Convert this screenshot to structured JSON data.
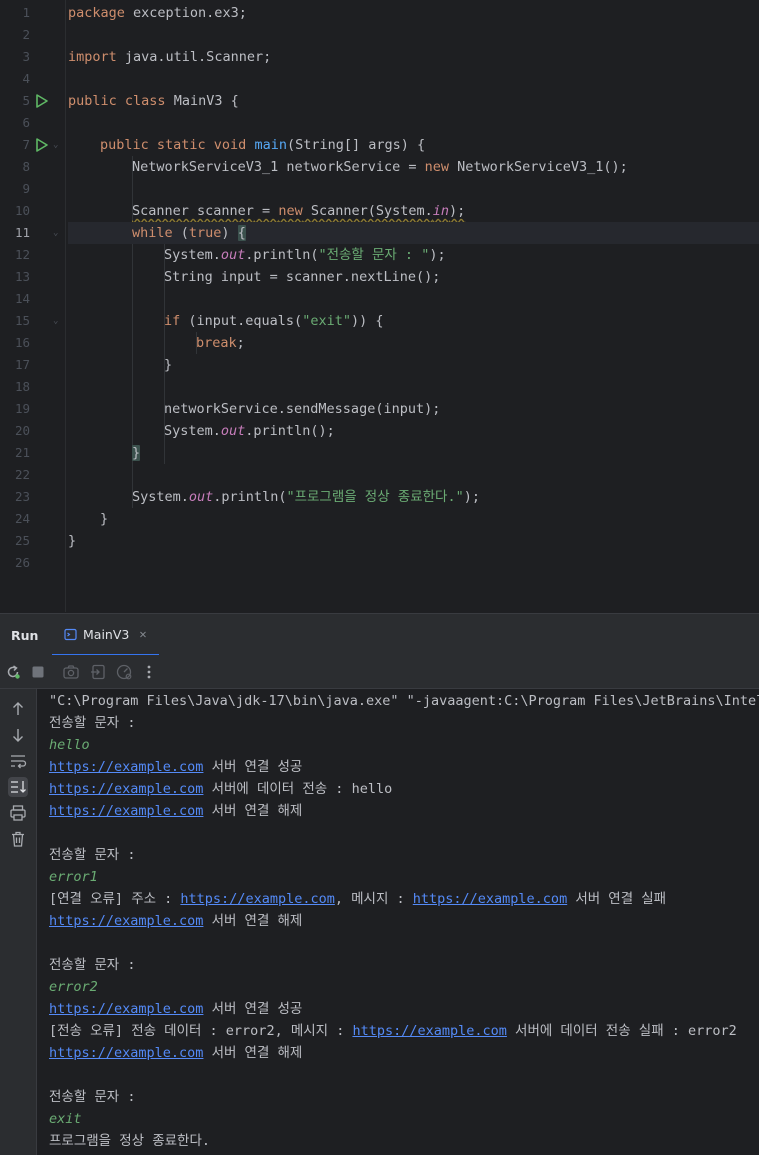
{
  "editor": {
    "line_numbers": [
      "1",
      "2",
      "3",
      "4",
      "5",
      "6",
      "7",
      "8",
      "9",
      "10",
      "11",
      "12",
      "13",
      "14",
      "15",
      "16",
      "17",
      "18",
      "19",
      "20",
      "21",
      "22",
      "23",
      "24",
      "25",
      "26"
    ],
    "current_line": "11",
    "code": {
      "l1_pkg_kw": "package",
      "l1_pkg": " exception.ex3;",
      "l3_imp_kw": "import",
      "l3_imp": " java.util.Scanner;",
      "l5_public": "public",
      "l5_class": " class",
      "l5_rest": " MainV3 {",
      "l7_mods": "public static void",
      "l7_main": "main",
      "l7_rest": "(String[] args) {",
      "l8_a": "NetworkServiceV3_1 networkService = ",
      "l8_new": "new",
      "l8_b": " NetworkServiceV3_1();",
      "l10_decl": "Scanner scanner",
      "l10_eq": " = ",
      "l10_new": "new",
      "l10_b": " Scanner(System.",
      "l10_in": "in",
      "l10_c": ");",
      "l11_while": "while",
      "l11_b": " (",
      "l11_true": "true",
      "l11_c": ") ",
      "l11_brace": "{",
      "l12_a": "System.",
      "l12_out": "out",
      "l12_b": ".println(",
      "l12_str": "\"전송할 문자 : \"",
      "l12_c": ");",
      "l13": "String input = scanner.nextLine();",
      "l15_if": "if",
      "l15_a": " (input.equals(",
      "l15_str": "\"exit\"",
      "l15_b": ")) {",
      "l16_break": "break",
      "l16_semi": ";",
      "l17": "}",
      "l19": "networkService.sendMessage(input);",
      "l20_a": "System.",
      "l20_out": "out",
      "l20_b": ".println();",
      "l21": "}",
      "l23_a": "System.",
      "l23_out": "out",
      "l23_b": ".println(",
      "l23_str": "\"프로그램을 정상 종료한다.\"",
      "l23_c": ");",
      "l24": "}",
      "l25": "}"
    }
  },
  "run_panel": {
    "title": "Run",
    "tab_label": "MainV3",
    "close_glyph": "✕"
  },
  "toolbar_icons": [
    "rerun-icon",
    "stop-icon",
    "screenshot-icon",
    "exit-icon",
    "debug-icon",
    "more-icon"
  ],
  "side_icons": [
    "arrow-up-icon",
    "arrow-down-icon",
    "soft-wrap-icon",
    "scroll-to-end-icon",
    "print-icon",
    "trash-icon"
  ],
  "console": {
    "cmd": "\"C:\\Program Files\\Java\\jdk-17\\bin\\java.exe\" \"-javaagent:C:\\Program Files\\JetBrains\\Intell",
    "prompt": "전송할 문자 :",
    "url": "https://example.com",
    "connect_ok": " 서버 연결 성공",
    "send_ok": " 서버에 데이터 전송 : hello",
    "disconnect": " 서버 연결 해제",
    "in_hello": "hello",
    "in_error1": "error1",
    "in_error2": "error2",
    "in_exit": "exit",
    "err1_prefix": "[연결 오류] 주소 : ",
    "err1_mid": ", 메시지 : ",
    "err1_suffix": " 서버 연결 실패",
    "err2_prefix": "[전송 오류] 전송 데이터 : error2, 메시지 : ",
    "err2_suffix": " 서버에 데이터 전송 실패 : error2",
    "end": "프로그램을 정상 종료한다."
  },
  "colors": {
    "keyword": "#cf8e6d",
    "function": "#56a8f5",
    "string": "#6aab73",
    "static_field": "#c77dbb",
    "link": "#548af7",
    "accent": "#3574f0",
    "run_icon": "#5fb865"
  }
}
